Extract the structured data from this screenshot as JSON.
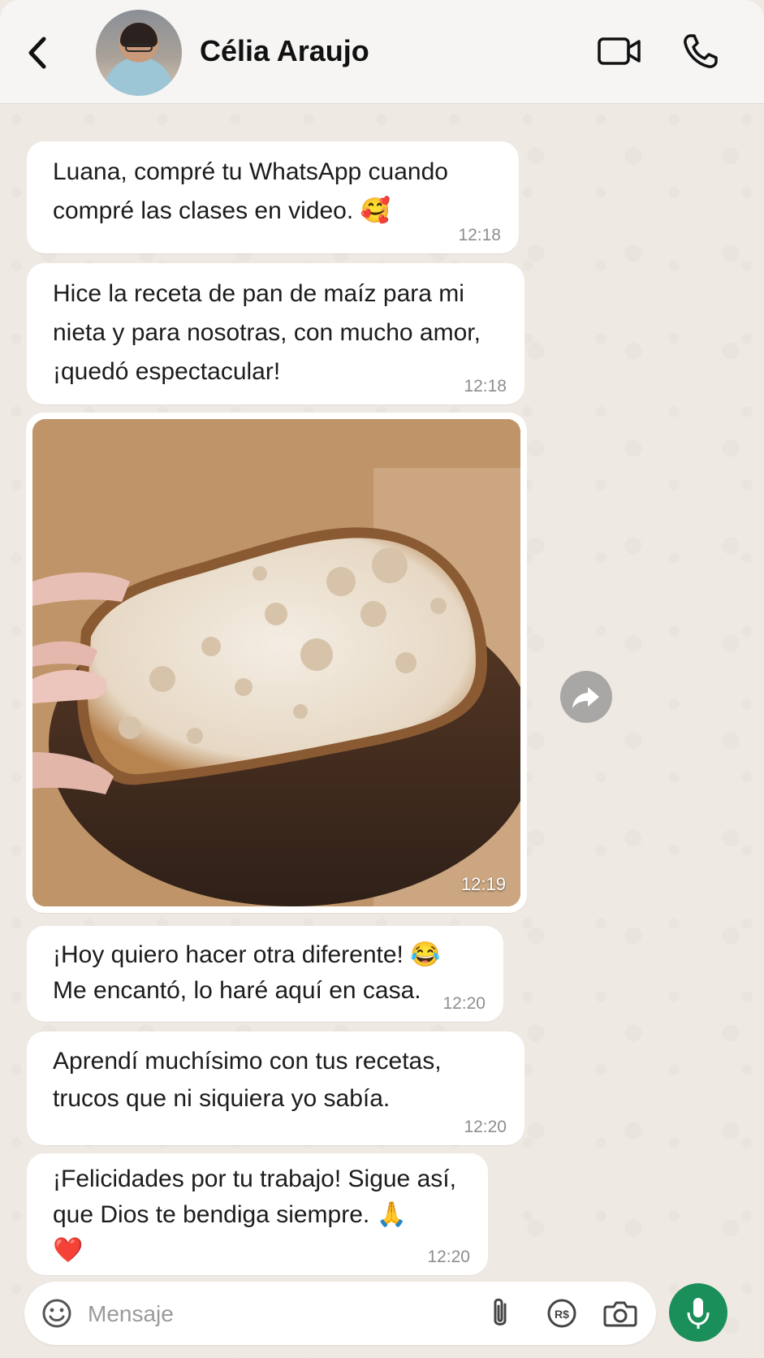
{
  "header": {
    "contact_name": "Célia Araujo",
    "back_icon": "chevron-left-icon",
    "video_icon": "video-camera-icon",
    "call_icon": "phone-icon"
  },
  "messages": [
    {
      "text": "Luana, compré tu WhatsApp cuando\ncompré las clases en video. 🥰",
      "time": "12:18"
    },
    {
      "text": "Hice la receta de pan de maíz para mi\nnieta y para nosotras, con mucho amor,\n¡quedó espectacular!",
      "time": "12:18"
    },
    {
      "type": "image",
      "alt": "bread",
      "time": "12:19"
    },
    {
      "text": "¡Hoy quiero hacer otra diferente! 😂\nMe encantó, lo haré aquí en casa.",
      "time": "12:20"
    },
    {
      "text": "Aprendí muchísimo con tus recetas,\ntrucos que ni siquiera yo sabía.",
      "time": "12:20"
    },
    {
      "text": "¡Felicidades por tu trabajo! Sigue así,\nque Dios te bendiga siempre. 🙏\n❤️",
      "time": "12:20"
    }
  ],
  "composer": {
    "placeholder": "Mensaje",
    "emoji_icon": "emoji-icon",
    "attach_icon": "paperclip-icon",
    "rs_icon": "currency-rs-icon",
    "camera_icon": "camera-icon",
    "mic_icon": "microphone-icon"
  },
  "colors": {
    "background": "#efe9e3",
    "bubble": "#ffffff",
    "accent_green": "#1b8f5a",
    "time_text": "#8e8e8e"
  }
}
